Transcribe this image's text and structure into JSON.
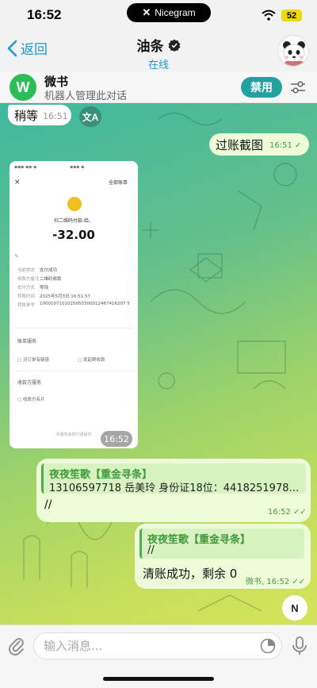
{
  "status": {
    "time": "16:52",
    "island_label": "Nicegram",
    "battery": "52"
  },
  "header": {
    "back_label": "返回",
    "title": "油条",
    "subtitle": "在线"
  },
  "bot": {
    "logo_letter": "W",
    "name": "微书",
    "description": "机器人管理此对话",
    "ban_label": "禁用"
  },
  "messages": [
    {
      "text": "稍等",
      "time": "16:51"
    },
    {
      "text": "过账截图",
      "time": "16:51"
    },
    {
      "text": "//",
      "time": "16:52",
      "quote_name": "夜夜笙歌【重金寻条】",
      "quote_text": "13106597718 岳美玲 身份证18位：44182519781..."
    },
    {
      "text": "清账成功，剩余 0",
      "time": "微书, 16:52",
      "quote_name": "夜夜笙歌【重金寻条】",
      "quote_text": "//"
    }
  ],
  "translate_badge": "文A",
  "receipt": {
    "close": "×",
    "link": "全部账单",
    "merchant": "扫二维码付款-给。",
    "amount": "-32.00",
    "rows": [
      {
        "k": "当前状态",
        "v": "支付成功"
      },
      {
        "k": "收款方备注",
        "v": "二维码收款"
      },
      {
        "k": "支付方式",
        "v": "零钱"
      },
      {
        "k": "转账时间",
        "v": "2025年5月3日 16:51:57"
      },
      {
        "k": "转账单号",
        "v": "1000107101025050300012467416207 5"
      }
    ],
    "section1": "账单服务",
    "action1": "对订单有疑惑",
    "action2": "发起群收款",
    "section2": "收款方服务",
    "action3": "收款方名片",
    "footer": "本服务由财付通提供",
    "time": "16:52"
  },
  "scroll_button_label": "N",
  "input": {
    "placeholder": "输入消息..."
  },
  "colors": {
    "accent": "#2196d3",
    "bot_green": "#2bbd56",
    "ban_teal": "#23a0a0",
    "quote_green": "#3f9a3c"
  }
}
